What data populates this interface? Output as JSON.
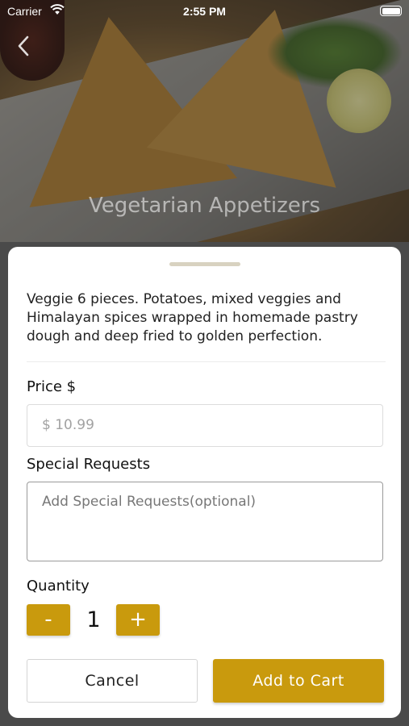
{
  "status_bar": {
    "carrier": "Carrier",
    "time": "2:55 PM",
    "icons": [
      "wifi-icon",
      "battery-icon"
    ]
  },
  "header": {
    "back_icon": "chevron-left-icon",
    "category_title": "Vegetarian Appetizers"
  },
  "item": {
    "description": "Veggie 6 pieces. Potatoes, mixed veggies and Himalayan spices wrapped in homemade pastry dough and deep fried to golden perfection.",
    "price_label": "Price $",
    "price_value": "$ 10.99",
    "special_requests_label": "Special Requests",
    "special_requests_placeholder": "Add Special Requests(optional)",
    "quantity_label": "Quantity",
    "quantity_minus": "-",
    "quantity_value": "1",
    "quantity_plus": "+"
  },
  "actions": {
    "cancel_label": "Cancel",
    "add_label": "Add to Cart"
  },
  "colors": {
    "accent": "#c99a0d",
    "text": "#222222"
  }
}
